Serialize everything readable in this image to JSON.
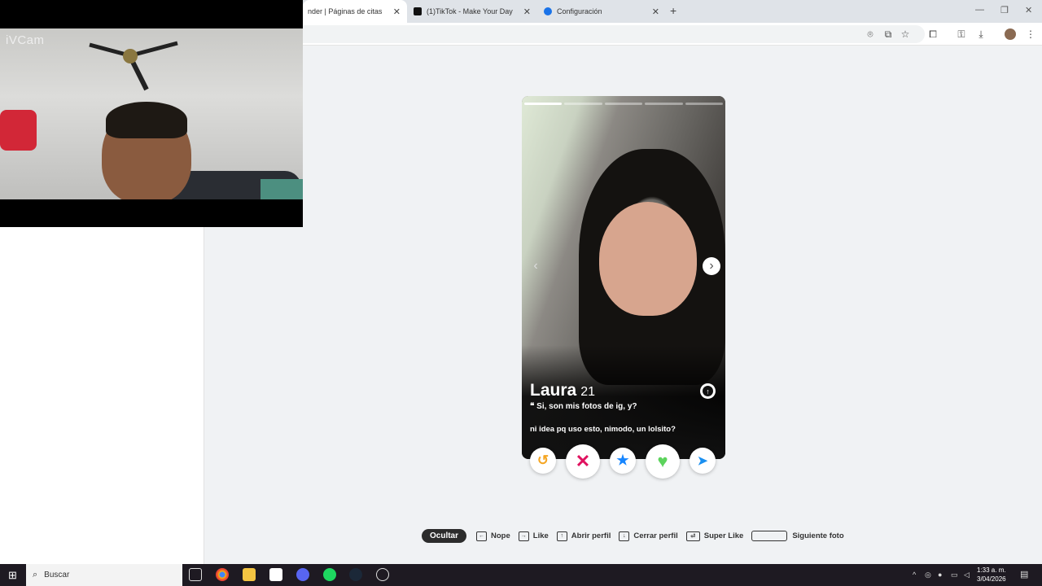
{
  "browser": {
    "tabs": [
      {
        "title": "nder | Páginas de citas",
        "active": true
      },
      {
        "title": "(1)TikTok - Make Your Day",
        "active": false
      },
      {
        "title": "Configuración",
        "active": false
      }
    ],
    "toolbar_icons": [
      "location-icon",
      "install-icon",
      "star-icon",
      "extensions-icon",
      "key-icon",
      "download-icon",
      "avatar",
      "menu-icon"
    ]
  },
  "webcam": {
    "brand": "iVCam"
  },
  "card": {
    "name": "Laura",
    "age": "21",
    "bio_line1": "Si, son mis fotos de ig, y?",
    "bio_line2": "ni idea pq uso esto, nimodo, un lolsito?",
    "photo_count": 5,
    "photo_index": 1
  },
  "actions": {
    "rewind": "rewind",
    "nope": "nope",
    "super_like": "super like",
    "like": "like",
    "boost": "boost"
  },
  "shortcuts": {
    "hide": "Ocultar",
    "nope": "Nope",
    "like": "Like",
    "open": "Abrir perfil",
    "close": "Cerrar perfil",
    "super": "Super Like",
    "next": "Siguiente foto"
  },
  "taskbar": {
    "search_placeholder": "Buscar",
    "time": "1:33 a. m.",
    "date": "3/04/2026"
  },
  "colors": {
    "accent_nope": "#e0115f",
    "accent_super": "#1786ff",
    "accent_like": "#5cd35c",
    "accent_rewind": "#f5a623"
  }
}
